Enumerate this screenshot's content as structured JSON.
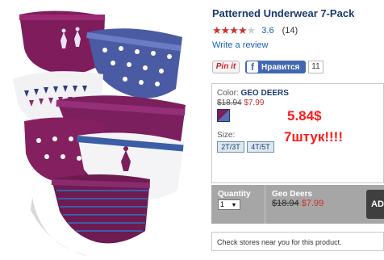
{
  "product": {
    "title": "Patterned Underwear 7-Pack",
    "rating": 3.5,
    "rating_display": "3.6",
    "review_count": "(14)",
    "write_review": "Write a review",
    "image_alt": "seven patterned underwear in purple, blue and white"
  },
  "social": {
    "pin_label": "Pin it",
    "like_label": "Нравится",
    "like_count": "11"
  },
  "options": {
    "color_label": "Color:",
    "color_name": "GEO DEERS",
    "price_old": "$18.94",
    "price_new": "$7.99",
    "size_label": "Size:",
    "sizes": [
      "2T/3T",
      "4T/5T"
    ]
  },
  "annotations": {
    "price_note": "5.84$",
    "count_note": "7штук!!!!"
  },
  "cart": {
    "quantity_label": "Quantity",
    "quantity_value": "1",
    "item_name": "Geo Deers",
    "price_old": "$18.94",
    "price_new": "$7.99",
    "add_button": "AD"
  },
  "stores": {
    "text": "Check stores near you for this product."
  },
  "colors": {
    "title": "#1a3a6e",
    "link": "#1a5fb4",
    "sale_red": "#d0312d",
    "annotation_red": "#ff1a1a",
    "cart_bar": "#a6a6a6"
  }
}
